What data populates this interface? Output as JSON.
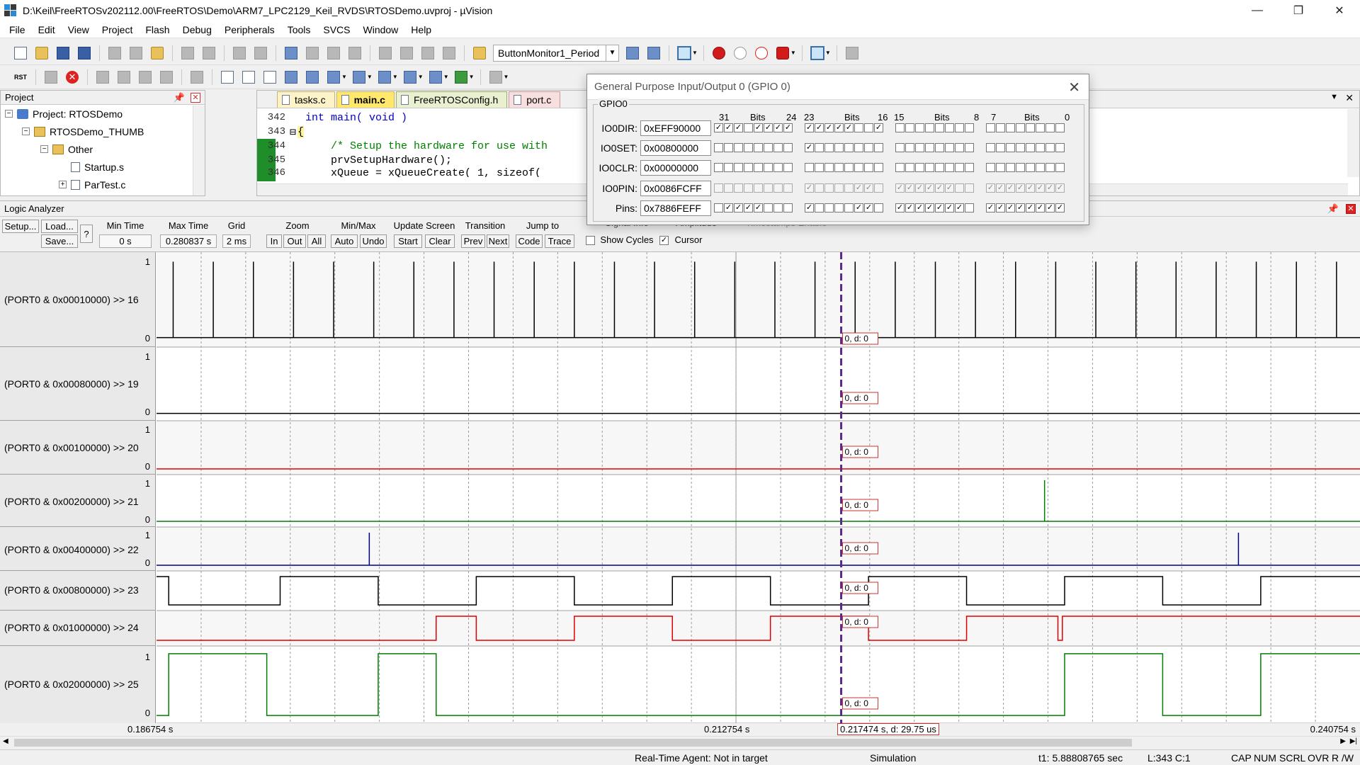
{
  "window": {
    "title": "D:\\Keil\\FreeRTOSv202112.00\\FreeRTOS\\Demo\\ARM7_LPC2129_Keil_RVDS\\RTOSDemo.uvproj - µVision",
    "minimize": "—",
    "restore": "❐",
    "close": "✕"
  },
  "menu": [
    "File",
    "Edit",
    "View",
    "Project",
    "Flash",
    "Debug",
    "Peripherals",
    "Tools",
    "SVCS",
    "Window",
    "Help"
  ],
  "toolbar": {
    "target_combo": "ButtonMonitor1_Period",
    "rst_label": "RST"
  },
  "project": {
    "title": "Project",
    "root": "Project: RTOSDemo",
    "target": "RTOSDemo_THUMB",
    "group": "Other",
    "files": [
      "Startup.s",
      "ParTest.c"
    ]
  },
  "editor": {
    "tabs": [
      "tasks.c",
      "main.c",
      "FreeRTOSConfig.h",
      "port.c"
    ],
    "active_tab": "main.c",
    "lines": [
      {
        "num": "342",
        "text": "int main( void )"
      },
      {
        "num": "343",
        "text": "{"
      },
      {
        "num": "344",
        "text": "    /* Setup the hardware for use with"
      },
      {
        "num": "345",
        "text": "    prvSetupHardware();"
      },
      {
        "num": "346",
        "text": "    xQueue = xQueueCreate( 1, sizeof("
      }
    ]
  },
  "gpio": {
    "title": "General Purpose Input/Output 0 (GPIO 0)",
    "group": "GPIO0",
    "header": {
      "b31": "31",
      "bits1": "Bits",
      "b24": "24",
      "b23": "23",
      "bits2": "Bits",
      "b16": "16",
      "b15": "15",
      "bits3": "Bits",
      "b8": "8",
      "b7": "7",
      "bits4": "Bits",
      "b0": "0"
    },
    "registers": [
      {
        "name": "IO0DIR:",
        "value": "0xEFF90000",
        "bits": "11101111111110010000000000000000"
      },
      {
        "name": "IO0SET:",
        "value": "0x00800000",
        "bits": "00000000100000000000000000000000"
      },
      {
        "name": "IO0CLR:",
        "value": "0x00000000",
        "bits": "00000000000000000000000000000000"
      },
      {
        "name": "IO0PIN:",
        "value": "0x0086FCFF",
        "bits": "00000000100001101111110011111111"
      },
      {
        "name": "Pins:",
        "value": "0x7886FEFF",
        "bits": "01111000100001101111111011111111"
      }
    ]
  },
  "logic_analyzer": {
    "title": "Logic Analyzer",
    "buttons": {
      "setup": "Setup...",
      "load": "Load...",
      "save": "Save...",
      "help": "?",
      "zoom_in": "In",
      "zoom_out": "Out",
      "zoom_all": "All",
      "auto": "Auto",
      "undo": "Undo",
      "start": "Start",
      "clear": "Clear",
      "prev": "Prev",
      "next": "Next",
      "code": "Code",
      "trace": "Trace"
    },
    "labels": {
      "min_time": "Min Time",
      "max_time": "Max Time",
      "grid": "Grid",
      "zoom": "Zoom",
      "min_max": "Min/Max",
      "update_screen": "Update Screen",
      "transition": "Transition",
      "jump_to": "Jump to",
      "signal_info": "Signal Info",
      "amplitude": "Amplitude",
      "timestamps": "Timestamps Enable",
      "show_cycles": "Show Cycles",
      "cursor": "Cursor"
    },
    "values": {
      "min_time": "0 s",
      "max_time": "0.280837 s",
      "grid": "2 ms"
    },
    "checks": {
      "show_cycles": false,
      "cursor": true
    },
    "signals": [
      {
        "name": "(PORT0 & 0x00010000) >> 16",
        "hi": "1",
        "lo": "0",
        "color": "#000000"
      },
      {
        "name": "(PORT0 & 0x00080000) >> 19",
        "hi": "1",
        "lo": "0",
        "color": "#000000"
      },
      {
        "name": "(PORT0 & 0x00100000) >> 20",
        "hi": "1",
        "lo": "0",
        "color": "#e00000"
      },
      {
        "name": "(PORT0 & 0x00200000) >> 21",
        "hi": "1",
        "lo": "0",
        "color": "#008000"
      },
      {
        "name": "(PORT0 & 0x00400000) >> 22",
        "hi": "1",
        "lo": "0",
        "color": "#000080"
      },
      {
        "name": "(PORT0 & 0x00800000) >> 23",
        "hi": "",
        "lo": "",
        "color": "#000000"
      },
      {
        "name": "(PORT0 & 0x01000000) >> 24",
        "hi": "",
        "lo": "",
        "color": "#e00000"
      },
      {
        "name": "(PORT0 & 0x02000000) >> 25",
        "hi": "1",
        "lo": "0",
        "color": "#008000"
      }
    ],
    "cursor_label": "0,  d: 0",
    "time_axis": {
      "left": "0.186754 s",
      "mid": "0.212754 s",
      "cursor": "0.217474 s,  d: 29.75 us",
      "right": "0.240754 s"
    }
  },
  "chart_data": {
    "type": "line",
    "xlabel": "",
    "ylabel": "",
    "xlim": [
      0.186754,
      0.240754
    ],
    "x_ticks": [
      "0.186754 s",
      "0.212754 s",
      "0.240754 s"
    ],
    "cursor_x": 0.217474,
    "series": [
      {
        "name": "(PORT0 & 0x00010000) >> 16",
        "kind": "pulses",
        "x": [
          0.1875,
          0.1893,
          0.1911,
          0.1929,
          0.1947,
          0.1965,
          0.1983,
          0.2001,
          0.2019,
          0.2037,
          0.2055,
          0.2073,
          0.2091,
          0.2109,
          0.2127,
          0.2145,
          0.2163,
          0.2181,
          0.2199,
          0.2217,
          0.2235,
          0.2253,
          0.2271,
          0.2289,
          0.2307,
          0.2325,
          0.2343,
          0.2361,
          0.2379,
          0.2397
        ]
      },
      {
        "name": "(PORT0 & 0x00080000) >> 19",
        "kind": "steps",
        "x": [
          0.186754,
          0.240754
        ],
        "y": [
          0,
          0
        ]
      },
      {
        "name": "(PORT0 & 0x00100000) >> 20",
        "kind": "steps",
        "x": [
          0.186754,
          0.240754
        ],
        "y": [
          0,
          0
        ]
      },
      {
        "name": "(PORT0 & 0x00200000) >> 21",
        "kind": "pulses",
        "x": [
          0.2266
        ]
      },
      {
        "name": "(PORT0 & 0x00400000) >> 22",
        "kind": "pulses",
        "x": [
          0.1963,
          0.2353
        ]
      },
      {
        "name": "(PORT0 & 0x00800000) >> 23",
        "kind": "steps",
        "x": [
          0.186754,
          0.1873,
          0.1923,
          0.1967,
          0.2011,
          0.2055,
          0.2099,
          0.2143,
          0.2187,
          0.2231,
          0.2275,
          0.2319,
          0.2363,
          0.240754
        ],
        "y": [
          1,
          0,
          1,
          0,
          1,
          0,
          1,
          0,
          1,
          0,
          1,
          0,
          1,
          0
        ]
      },
      {
        "name": "(PORT0 & 0x01000000) >> 24",
        "kind": "steps",
        "x": [
          0.186754,
          0.1993,
          0.2011,
          0.2055,
          0.2099,
          0.2143,
          0.2187,
          0.2231,
          0.2272,
          0.2274,
          0.240754
        ],
        "y": [
          0,
          1,
          0,
          1,
          0,
          1,
          0,
          1,
          0,
          1,
          0
        ]
      },
      {
        "name": "(PORT0 & 0x02000000) >> 25",
        "kind": "steps",
        "x": [
          0.186754,
          0.1873,
          0.1917,
          0.1967,
          0.1993,
          0.2275,
          0.2319,
          0.2363,
          0.240754
        ],
        "y": [
          0,
          1,
          0,
          1,
          0,
          1,
          0,
          1,
          1
        ]
      }
    ]
  }
}
